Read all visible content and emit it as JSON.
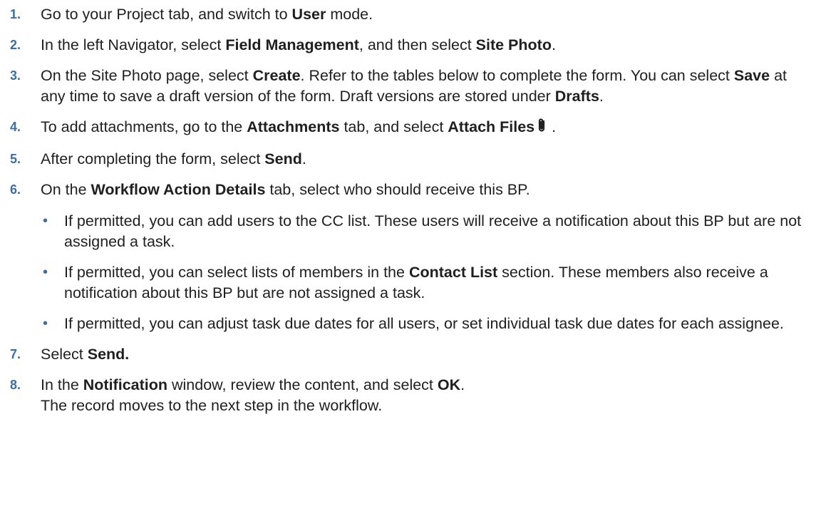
{
  "steps": [
    {
      "num": "1.",
      "t1": "Go to your Project tab, and switch to ",
      "b1": "User",
      "t2": " mode."
    },
    {
      "num": "2.",
      "t1": "In the left Navigator, select ",
      "b1": "Field Management",
      "t2": ", and then select ",
      "b2": "Site Photo",
      "t3": "."
    },
    {
      "num": "3.",
      "t1": "On the Site Photo page, select ",
      "b1": "Create",
      "t2": ". Refer to the tables below to complete the form. You can select ",
      "b2": "Save",
      "t3": " at any time to save a draft version of the form. Draft versions are stored under ",
      "b3": "Drafts",
      "t4": "."
    },
    {
      "num": "4.",
      "t1": "To add attachments, go to the ",
      "b1": "Attachments",
      "t2": " tab, and select ",
      "b2": "Attach Files",
      "t3": " ."
    },
    {
      "num": "5.",
      "t1": "After completing the form, select ",
      "b1": "Send",
      "t2": "."
    },
    {
      "num": "6.",
      "t1": "On the ",
      "b1": "Workflow Action Details",
      "t2": " tab, select who should receive this BP."
    },
    {
      "num": "7.",
      "t1": "Select ",
      "b1": "Send."
    },
    {
      "num": "8.",
      "t1": "In the ",
      "b1": "Notification",
      "t2": " window, review the content, and select ",
      "b2": "OK",
      "t3": ".",
      "line2": "The record moves to the next step in the workflow."
    }
  ],
  "bullets": [
    {
      "dot": "•",
      "text": "If permitted, you can add users to the CC list. These users will receive a notification about this BP but are not assigned a task."
    },
    {
      "dot": "•",
      "t1": "If permitted, you can select lists of members in the ",
      "b1": "Contact List",
      "t2": " section. These members also receive a notification about this BP but are not assigned a task."
    },
    {
      "dot": "•",
      "text": "If permitted, you can adjust task due dates for all users, or set individual task due dates for each assignee."
    }
  ],
  "icons": {
    "attach": "paperclip-icon"
  }
}
